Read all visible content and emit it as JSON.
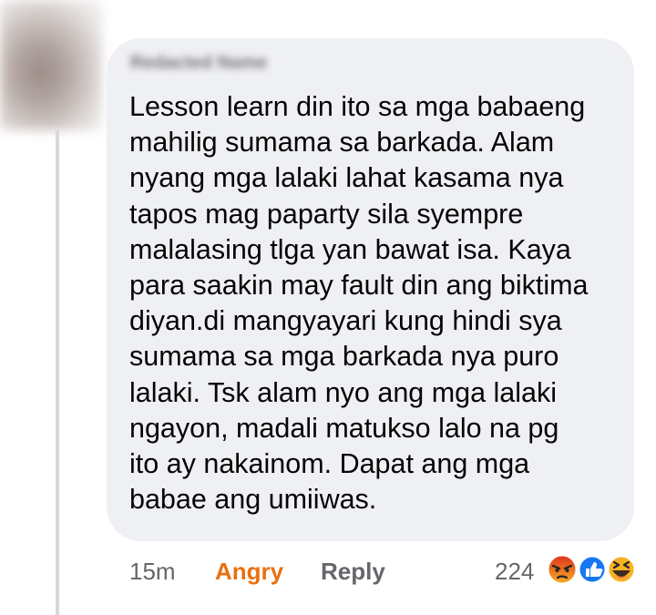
{
  "comment": {
    "author_name": "Redacted Name",
    "text_lines": [
      "Lesson learn din ito sa mga babaeng",
      "mahilig sumama sa barkada. Alam",
      "nyang mga lalaki lahat kasama nya",
      "tapos mag paparty sila syempre",
      "malalasing tlga yan bawat isa. Kaya",
      "para saakin may fault din ang biktima",
      "diyan.di mangyayari kung hindi sya",
      "sumama sa mga barkada nya puro",
      "lalaki. Tsk alam nyo ang mga lalaki",
      "ngayon, madali matukso lalo na pg",
      "ito ay nakainom. Dapat ang mga",
      "babae ang umiiwas."
    ],
    "timestamp": "15m",
    "my_reaction_label": "Angry",
    "reply_label": "Reply",
    "reaction_count": "224",
    "reaction_icons": [
      "angry-icon",
      "like-icon",
      "haha-icon"
    ]
  },
  "colors": {
    "bubble": "#eff0f3",
    "angry": "#e9710f",
    "like": "#1877f2",
    "haha": "#f7b125",
    "meta_text": "#65676b"
  }
}
